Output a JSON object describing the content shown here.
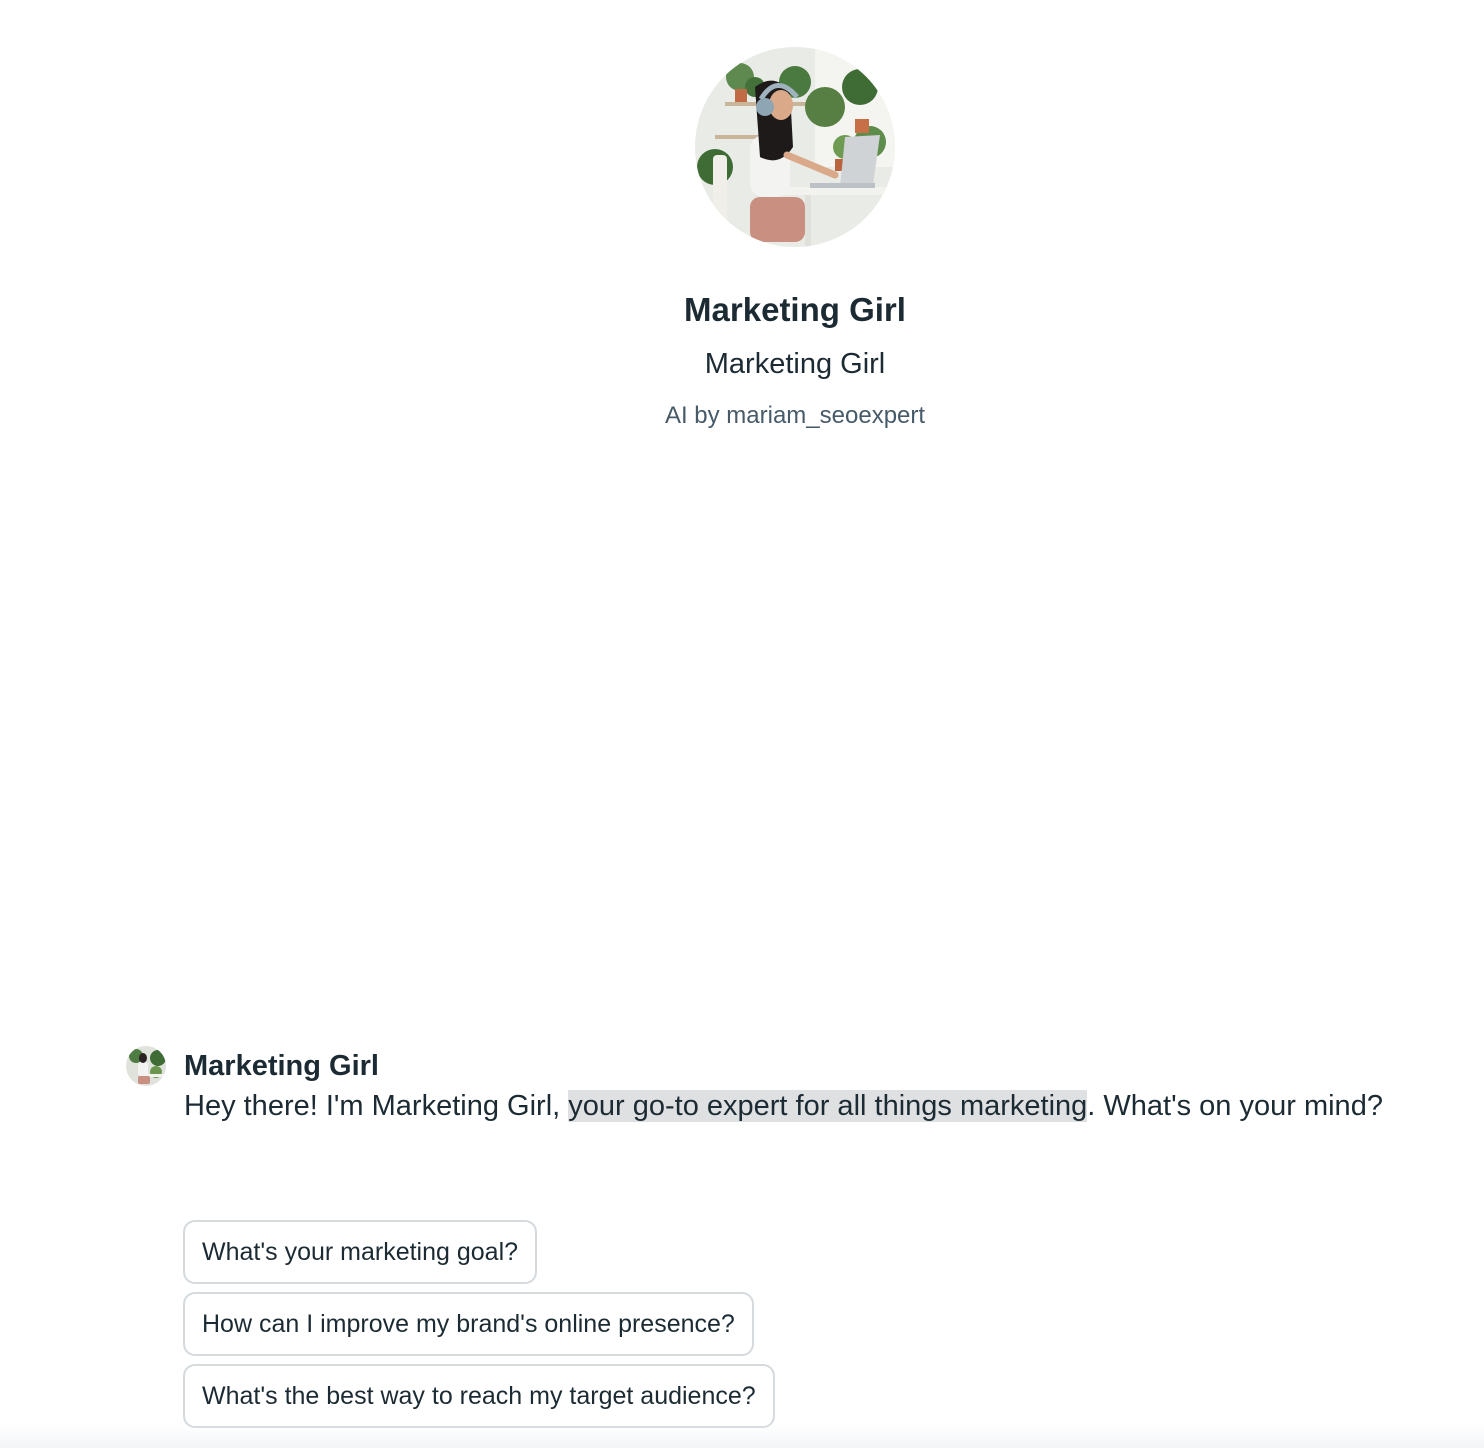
{
  "profile": {
    "avatar_icon": "profile-photo-woman-with-headphones-at-laptop",
    "name": "Marketing Girl",
    "subtitle": "Marketing Girl",
    "creator": "AI by mariam_seoexpert"
  },
  "message": {
    "avatar_icon": "sender-avatar-photo",
    "sender": "Marketing Girl",
    "text_before": "Hey there! I'm Marketing Girl, ",
    "text_highlighted": "your go-to expert for all things marketing",
    "text_after": ". What's on your mind?"
  },
  "suggestions": [
    {
      "label": "What's your marketing goal?"
    },
    {
      "label": "How can I improve my brand's online presence?"
    },
    {
      "label": "What's the best way to reach my target audience?"
    }
  ],
  "colors": {
    "text_primary": "#1c2b33",
    "text_secondary": "#465a69",
    "highlight_bg": "#dfe0e2",
    "chip_border": "#d5dadf"
  }
}
